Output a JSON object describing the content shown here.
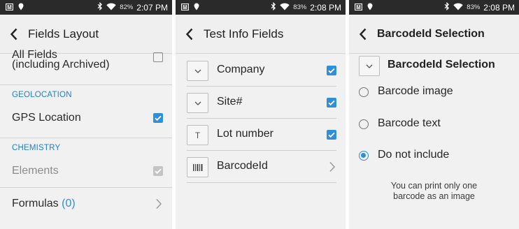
{
  "screens": [
    {
      "status": {
        "battery": "82%",
        "time": "2:07 PM"
      },
      "appbar": {
        "title": "Fields Layout"
      },
      "items": {
        "all_fields": {
          "label_line1": "All Fields",
          "label_line2": "(including Archived)"
        },
        "geolocation_header": "GEOLOCATION",
        "gps_location": {
          "label": "GPS Location",
          "checked": true
        },
        "chemistry_header": "CHEMISTRY",
        "elements": {
          "label": "Elements",
          "checked": true,
          "disabled": true
        },
        "formulas": {
          "label": "Formulas",
          "count": "(0)"
        }
      }
    },
    {
      "status": {
        "battery": "83%",
        "time": "2:08 PM"
      },
      "appbar": {
        "title": "Test Info Fields"
      },
      "rows": [
        {
          "label": "Company",
          "type_icon": "dropdown-icon",
          "checked": true
        },
        {
          "label": "Site#",
          "type_icon": "dropdown-icon",
          "checked": true
        },
        {
          "label": "Lot number",
          "type_icon": "text-icon",
          "type_text": "T",
          "checked": true
        },
        {
          "label": "BarcodeId",
          "type_icon": "barcode-icon"
        }
      ]
    },
    {
      "status": {
        "battery": "83%",
        "time": "2:08 PM"
      },
      "appbar": {
        "title": "BarcodeId Selection"
      },
      "header_label": "BarcodeId Selection",
      "options": [
        {
          "label": "Barcode image",
          "selected": false
        },
        {
          "label": "Barcode text",
          "selected": false
        },
        {
          "label": "Do not include",
          "selected": true
        }
      ],
      "note_line1": "You can print only one",
      "note_line2": "barcode as an image"
    }
  ],
  "colors": {
    "accent": "#2f8fd8",
    "section_header": "#1f7fd0",
    "statusbar": "#2a2a2a",
    "disabled": "#c4c4c4"
  }
}
